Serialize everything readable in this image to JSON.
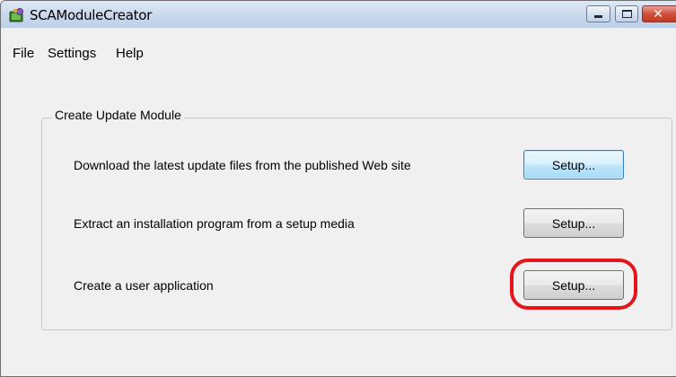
{
  "window": {
    "title": "SCAModuleCreator",
    "icon": "app-icon"
  },
  "menu": {
    "items": [
      "File",
      "Settings",
      "Help"
    ]
  },
  "group": {
    "title": "Create Update Module",
    "rows": [
      {
        "label": "Download the latest update files from the published Web site",
        "button": "Setup..."
      },
      {
        "label": "Extract an installation program from a setup media",
        "button": "Setup..."
      },
      {
        "label": "Create a user application",
        "button": "Setup..."
      }
    ]
  },
  "colors": {
    "highlight": "#e5151c",
    "focus_border": "#3c7fb1"
  }
}
